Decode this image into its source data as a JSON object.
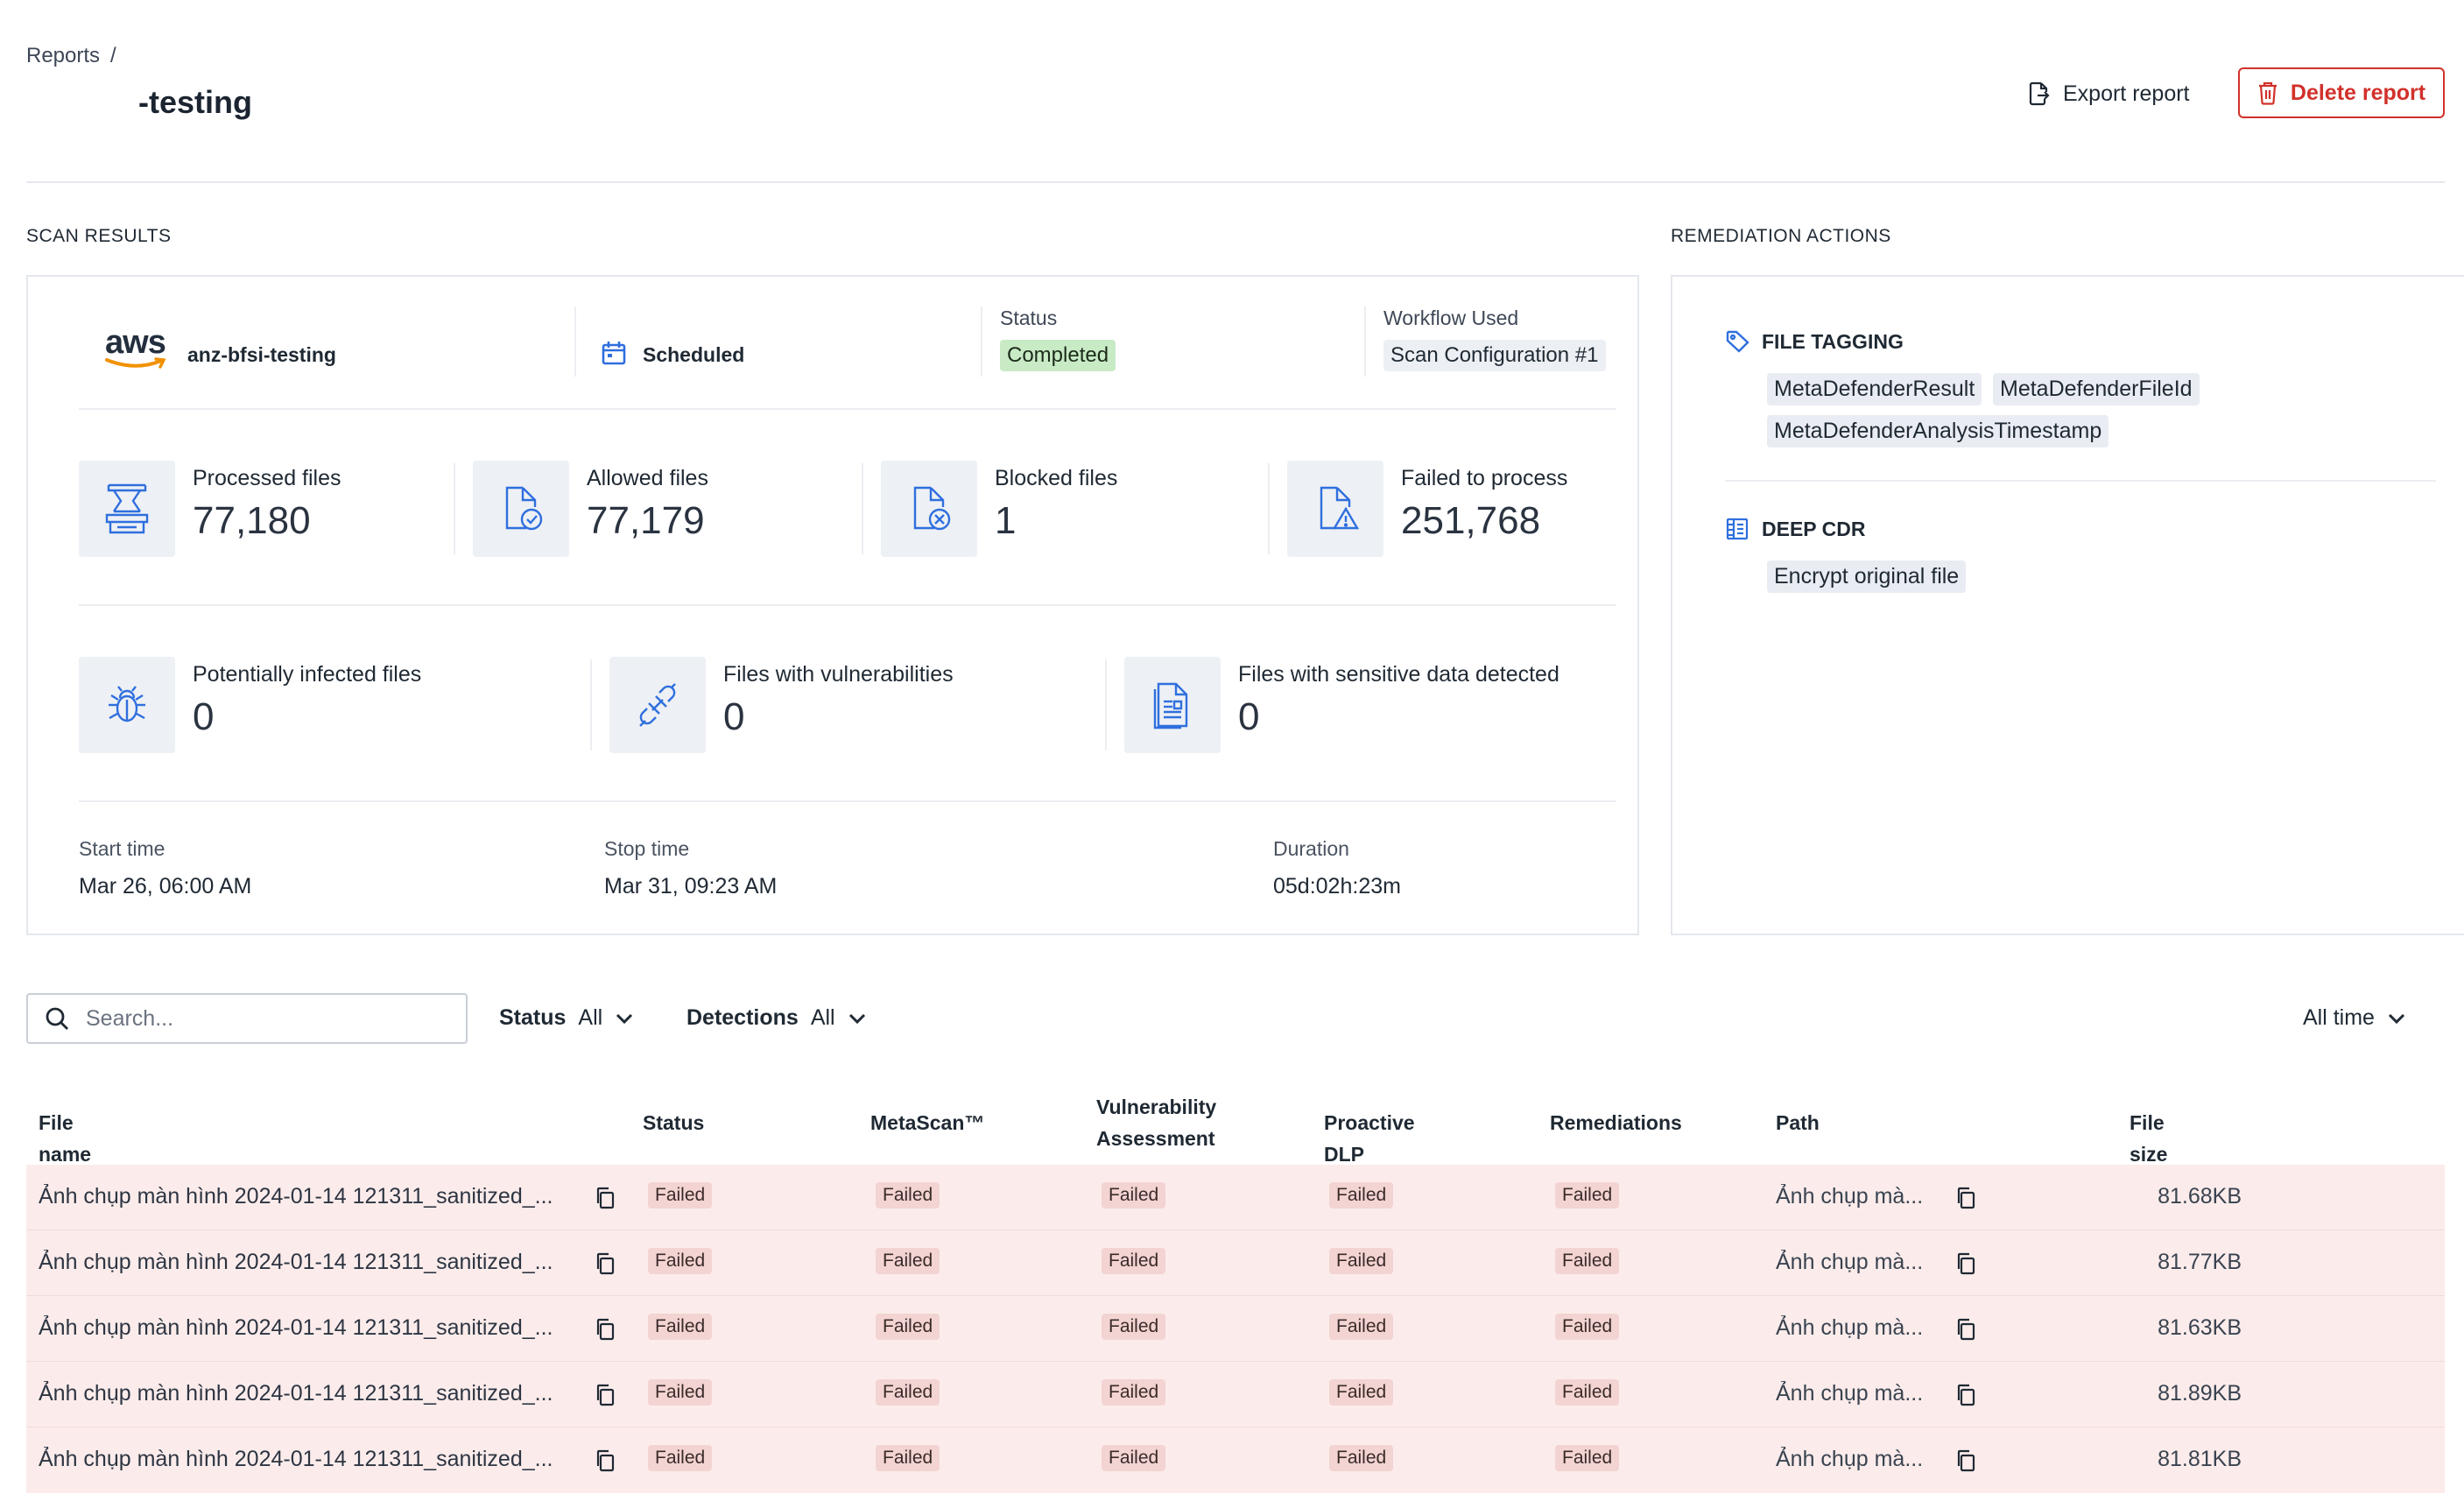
{
  "header": {
    "breadcrumb_root": "Reports",
    "breadcrumb_sep": "/",
    "title": "-testing",
    "export_label": "Export report",
    "delete_label": "Delete report"
  },
  "scan_results": {
    "section_title": "SCAN RESULTS",
    "source_logo": "aws",
    "source_name": "anz-bfsi-testing",
    "schedule_label": "Scheduled",
    "status_label": "Status",
    "status_value": "Completed",
    "workflow_label": "Workflow Used",
    "workflow_value": "Scan Configuration #1",
    "stats": [
      {
        "label": "Processed files",
        "value": "77,180",
        "icon": "processed-files-icon"
      },
      {
        "label": "Allowed files",
        "value": "77,179",
        "icon": "allowed-files-icon"
      },
      {
        "label": "Blocked files",
        "value": "1",
        "icon": "blocked-files-icon"
      },
      {
        "label": "Failed to process",
        "value": "251,768",
        "icon": "failed-files-icon"
      },
      {
        "label": "Potentially infected files",
        "value": "0",
        "icon": "bug-icon"
      },
      {
        "label": "Files with vulnerabilities",
        "value": "0",
        "icon": "broken-link-icon"
      },
      {
        "label": "Files with sensitive data detected",
        "value": "0",
        "icon": "sensitive-document-icon"
      }
    ],
    "start_label": "Start time",
    "start_value": "Mar 26, 06:00 AM",
    "stop_label": "Stop time",
    "stop_value": "Mar 31, 09:23 AM",
    "duration_label": "Duration",
    "duration_value": "05d:02h:23m"
  },
  "remediation": {
    "section_title": "REMEDIATION ACTIONS",
    "file_tagging_title": "FILE TAGGING",
    "tags": [
      "MetaDefenderResult",
      "MetaDefenderFileId",
      "MetaDefenderAnalysisTimestamp"
    ],
    "deep_cdr_title": "DEEP CDR",
    "cdr_options": [
      "Encrypt original file"
    ]
  },
  "filters": {
    "search_placeholder": "Search...",
    "status_label": "Status",
    "status_value": "All",
    "detections_label": "Detections",
    "detections_value": "All",
    "time_value": "All time"
  },
  "table": {
    "columns": [
      "File name",
      "Status",
      "MetaScan™",
      "Vulnerability Assessment",
      "Proactive DLP",
      "Remediations",
      "Path",
      "File size"
    ],
    "rows": [
      {
        "file": "Ảnh chụp màn hình 2024-01-14 121311_sanitized_...",
        "status": "Failed",
        "metascan": "Failed",
        "vuln": "Failed",
        "dlp": "Failed",
        "remed": "Failed",
        "path": "Ảnh chụp mà...",
        "size": "81.68KB"
      },
      {
        "file": "Ảnh chụp màn hình 2024-01-14 121311_sanitized_...",
        "status": "Failed",
        "metascan": "Failed",
        "vuln": "Failed",
        "dlp": "Failed",
        "remed": "Failed",
        "path": "Ảnh chụp mà...",
        "size": "81.77KB"
      },
      {
        "file": "Ảnh chụp màn hình 2024-01-14 121311_sanitized_...",
        "status": "Failed",
        "metascan": "Failed",
        "vuln": "Failed",
        "dlp": "Failed",
        "remed": "Failed",
        "path": "Ảnh chụp mà...",
        "size": "81.63KB"
      },
      {
        "file": "Ảnh chụp màn hình 2024-01-14 121311_sanitized_...",
        "status": "Failed",
        "metascan": "Failed",
        "vuln": "Failed",
        "dlp": "Failed",
        "remed": "Failed",
        "path": "Ảnh chụp mà...",
        "size": "81.89KB"
      },
      {
        "file": "Ảnh chụp màn hình 2024-01-14 121311_sanitized_...",
        "status": "Failed",
        "metascan": "Failed",
        "vuln": "Failed",
        "dlp": "Failed",
        "remed": "Failed",
        "path": "Ảnh chụp mà...",
        "size": "81.81KB"
      }
    ]
  },
  "colors": {
    "accent": "#2f6fde",
    "danger": "#d1312b",
    "success_bg": "#c8ebc6",
    "failed_row_bg": "#fbeceb"
  }
}
